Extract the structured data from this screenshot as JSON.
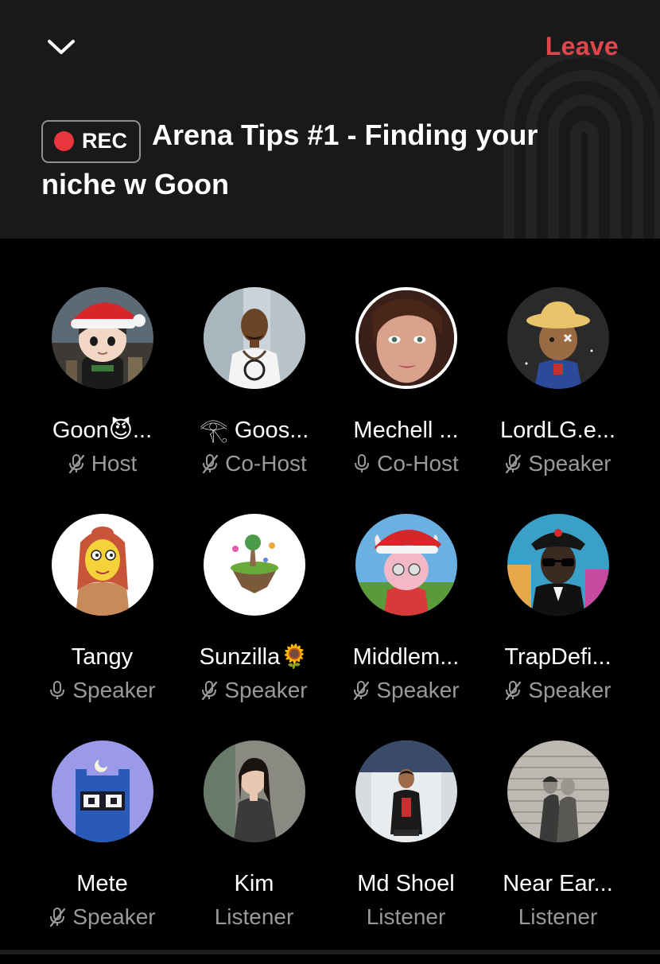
{
  "header": {
    "leave_label": "Leave",
    "rec_label": "REC",
    "title": "Arena Tips #1 - Finding your niche w Goon"
  },
  "colors": {
    "header_bg": "#19191a",
    "page_bg": "#000000",
    "leave": "#e0474c",
    "rec_dot": "#e8363c",
    "role_text": "#9a9a9a"
  },
  "participants": [
    {
      "name": "Goon😈...",
      "role": "Host",
      "mic": "muted",
      "avatar": "santa-hat-boy-avatar"
    },
    {
      "name": "𓂀 Goos...",
      "role": "Co-Host",
      "mic": "muted",
      "avatar": "man-white-shirt-avatar"
    },
    {
      "name": "Mechell ...",
      "role": "Co-Host",
      "mic": "on",
      "avatar": "woman-selfie-avatar"
    },
    {
      "name": "LordLG.e...",
      "role": "Speaker",
      "mic": "muted",
      "avatar": "cartoon-hat-avatar"
    },
    {
      "name": "Tangy",
      "role": "Speaker",
      "mic": "on",
      "avatar": "yellow-cartoon-woman-avatar"
    },
    {
      "name": "Sunzilla🌻",
      "role": "Speaker",
      "mic": "muted",
      "avatar": "floating-island-avatar"
    },
    {
      "name": "Middlem...",
      "role": "Speaker",
      "mic": "muted",
      "avatar": "pink-horned-santa-avatar"
    },
    {
      "name": "TrapDefi...",
      "role": "Speaker",
      "mic": "muted",
      "avatar": "sunglasses-man-avatar"
    },
    {
      "name": "Mete",
      "role": "Speaker",
      "mic": "muted",
      "avatar": "pixel-owl-avatar"
    },
    {
      "name": "Kim",
      "role": "Listener",
      "mic": "none",
      "avatar": "woman-photo-avatar"
    },
    {
      "name": "Md Shoel",
      "role": "Listener",
      "mic": "none",
      "avatar": "man-sitting-avatar"
    },
    {
      "name": "Near Ear...",
      "role": "Listener",
      "mic": "none",
      "avatar": "vintage-couple-avatar"
    }
  ]
}
